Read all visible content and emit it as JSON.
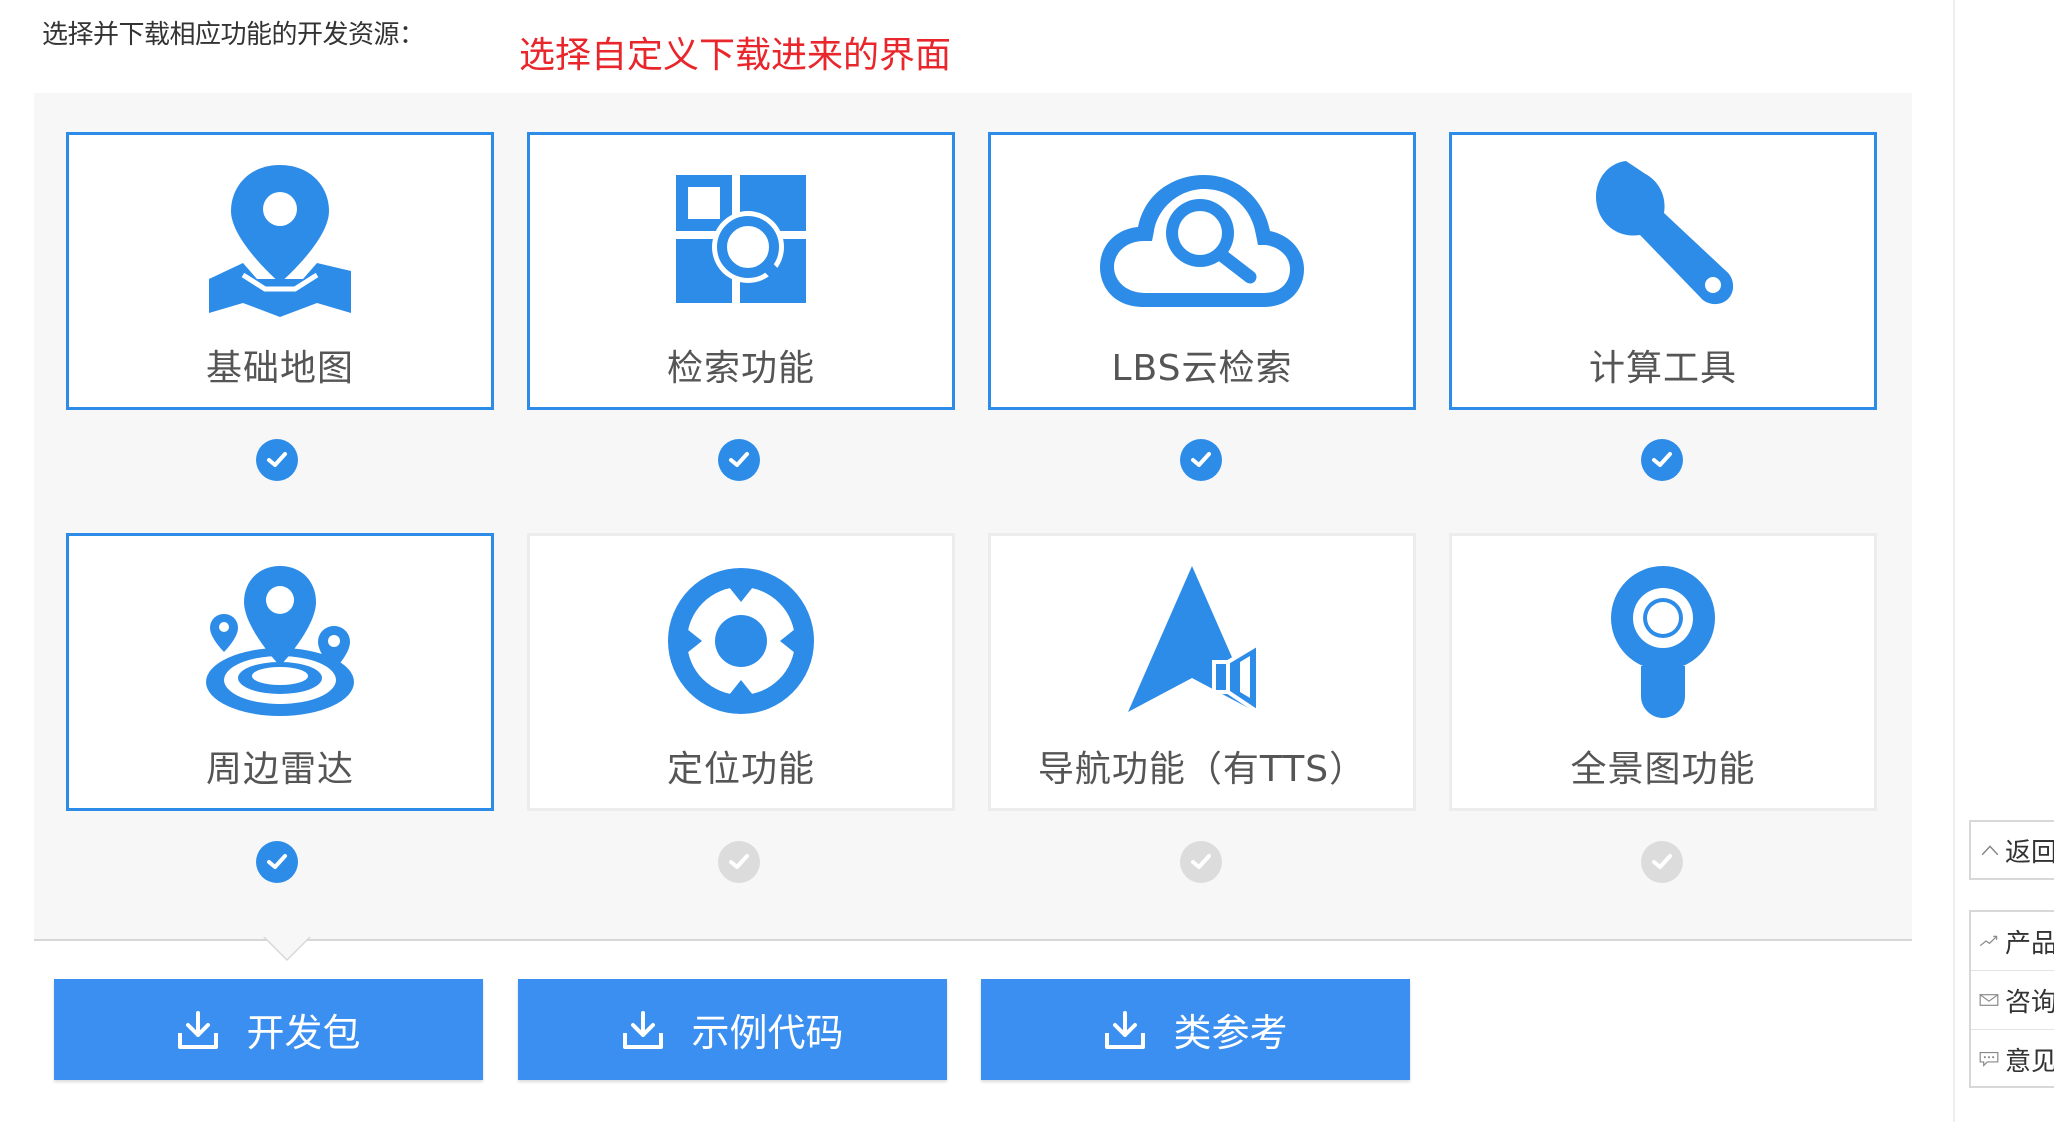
{
  "header": {
    "instruction": "选择并下载相应功能的开发资源：",
    "annotation": "选择自定义下载进来的界面"
  },
  "colors": {
    "accent": "#2d8ce8",
    "button": "#3b8ff0",
    "annotation": "#e8262b",
    "check_off": "#dcdcdc"
  },
  "features": [
    {
      "label": "基础地图",
      "icon": "map-pin-icon",
      "selected": true
    },
    {
      "label": "检索功能",
      "icon": "search-grid-icon",
      "selected": true
    },
    {
      "label": "LBS云检索",
      "icon": "cloud-search-icon",
      "selected": true
    },
    {
      "label": "计算工具",
      "icon": "wrench-icon",
      "selected": true
    },
    {
      "label": "周边雷达",
      "icon": "radar-icon",
      "selected": true
    },
    {
      "label": "定位功能",
      "icon": "locate-target-icon",
      "selected": false
    },
    {
      "label": "导航功能（有TTS）",
      "icon": "navigation-arrow-icon",
      "selected": false
    },
    {
      "label": "全景图功能",
      "icon": "panorama-icon",
      "selected": false
    }
  ],
  "buttons": {
    "sdk": "开发包",
    "sample": "示例代码",
    "reference": "类参考"
  },
  "sidebar": {
    "back_top": "返回",
    "items": [
      "产品",
      "咨询",
      "意见"
    ]
  }
}
